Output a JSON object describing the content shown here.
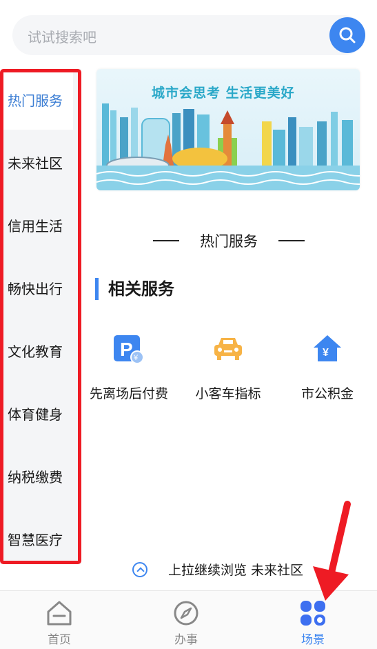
{
  "search": {
    "placeholder": "试试搜索吧"
  },
  "sidebar": {
    "items": [
      {
        "label": "热门服务",
        "active": true
      },
      {
        "label": "未来社区",
        "active": false
      },
      {
        "label": "信用生活",
        "active": false
      },
      {
        "label": "畅快出行",
        "active": false
      },
      {
        "label": "文化教育",
        "active": false
      },
      {
        "label": "体育健身",
        "active": false
      },
      {
        "label": "纳税缴费",
        "active": false
      },
      {
        "label": "智慧医疗",
        "active": false
      }
    ]
  },
  "banner": {
    "slogan": "城市会思考 生活更美好"
  },
  "section": {
    "title": "热门服务"
  },
  "related": {
    "title": "相关服务",
    "services": [
      {
        "label": "先离场后付费",
        "icon": "parking-pay-icon"
      },
      {
        "label": "小客车指标",
        "icon": "car-icon"
      },
      {
        "label": "市公积金",
        "icon": "housing-fund-icon"
      }
    ]
  },
  "pull_hint": {
    "text": "上拉继续浏览  未来社区"
  },
  "bottom_nav": {
    "items": [
      {
        "label": "首页",
        "icon": "home-icon",
        "active": false
      },
      {
        "label": "办事",
        "icon": "compass-icon",
        "active": false
      },
      {
        "label": "场景",
        "icon": "scene-icon",
        "active": true
      }
    ]
  },
  "colors": {
    "accent": "#3d86f0",
    "highlight": "#ee1b24",
    "car": "#f7b346"
  }
}
